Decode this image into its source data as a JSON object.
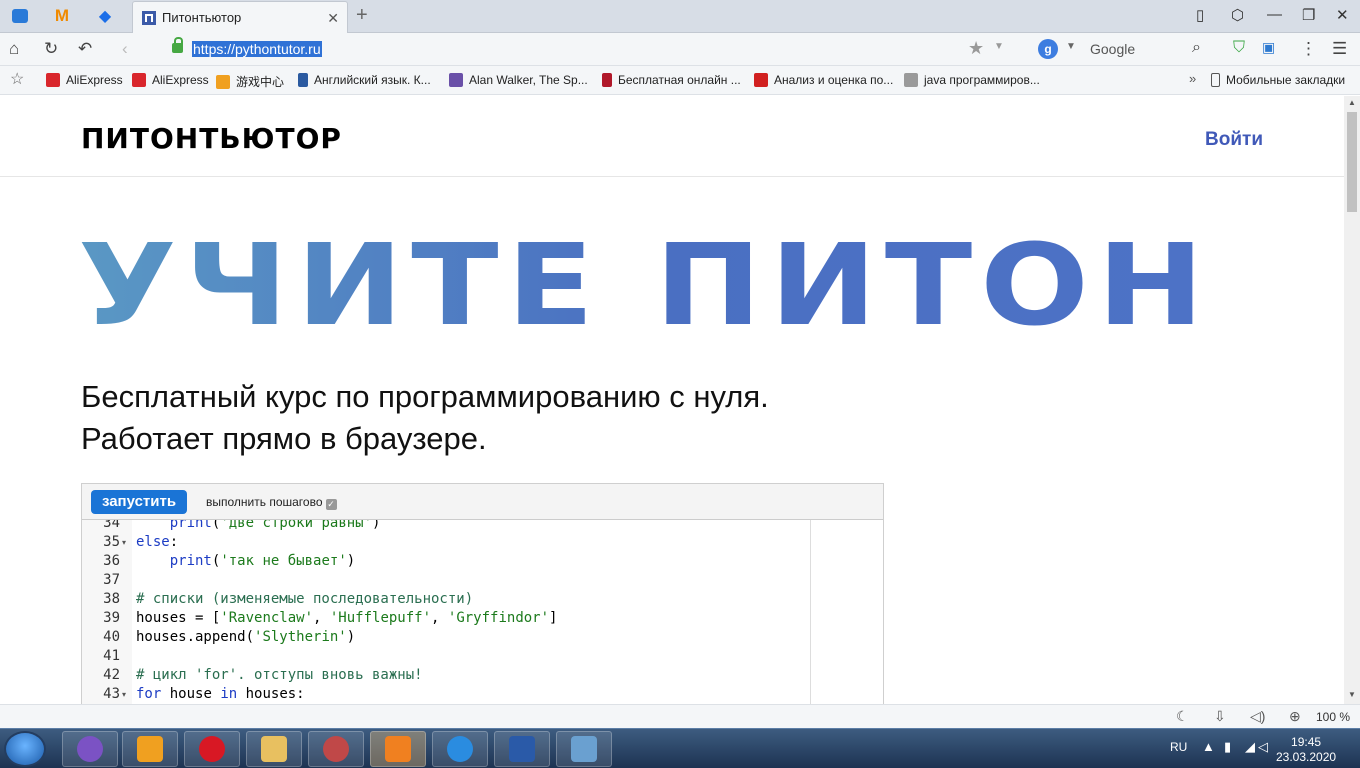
{
  "browser": {
    "tab_title": "Питонтьютор",
    "url": "https://pythontutor.ru",
    "search_engine": "Google",
    "bookmarks": [
      {
        "label": "AliExpress",
        "color": "#d9262c"
      },
      {
        "label": "AliExpress",
        "color": "#d9262c"
      },
      {
        "label": "游戏中心",
        "color": "#f0a020"
      },
      {
        "label": "Английский язык. К...",
        "color": "#2b5aa0"
      },
      {
        "label": "Alan Walker, The Sp...",
        "color": "#6a50a8"
      },
      {
        "label": "Бесплатная онлайн ...",
        "color": "#b0182a"
      },
      {
        "label": "Анализ и оценка по...",
        "color": "#d12020"
      },
      {
        "label": "java программиров...",
        "color": "#9a9a9a"
      }
    ],
    "mobile_bookmarks": "Мобильные закладки",
    "zoom": "100 %"
  },
  "site": {
    "logo": "ПИТОНТЬЮТОР",
    "login": "Войти",
    "hero": "УЧИТЕ ПИТОН",
    "subtitle_line1": "Бесплатный курс по программированию с нуля.",
    "subtitle_line2": "Работает прямо в браузере."
  },
  "editor": {
    "run_label": "запустить",
    "step_label": "выполнить пошагово",
    "lines": [
      {
        "n": "34",
        "fold": false,
        "code": "    print('две строки равны')"
      },
      {
        "n": "35",
        "fold": true,
        "code": "else:"
      },
      {
        "n": "36",
        "fold": false,
        "code": "    print('так не бывает')"
      },
      {
        "n": "37",
        "fold": false,
        "code": ""
      },
      {
        "n": "38",
        "fold": false,
        "code": "# списки (изменяемые последовательности)"
      },
      {
        "n": "39",
        "fold": false,
        "code": "houses = ['Ravenclaw', 'Hufflepuff', 'Gryffindor']"
      },
      {
        "n": "40",
        "fold": false,
        "code": "houses.append('Slytherin')"
      },
      {
        "n": "41",
        "fold": false,
        "code": ""
      },
      {
        "n": "42",
        "fold": false,
        "code": "# цикл 'for'. отступы вновь важны!"
      },
      {
        "n": "43",
        "fold": true,
        "code": "for house in houses:"
      }
    ]
  },
  "taskbar": {
    "lang": "RU",
    "time": "19:45",
    "date": "23.03.2020"
  }
}
